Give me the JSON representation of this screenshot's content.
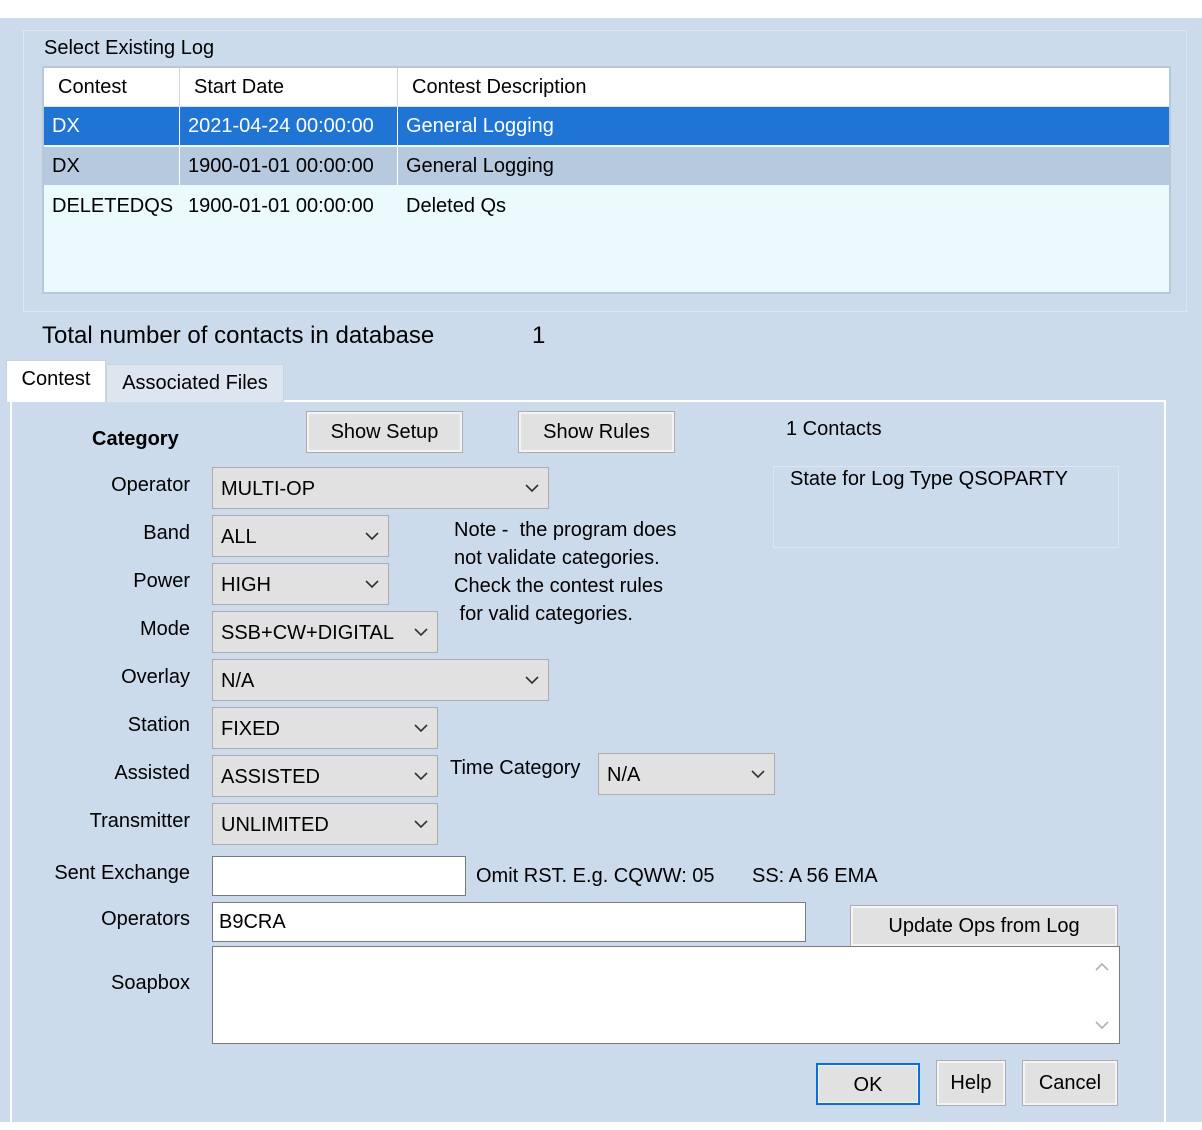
{
  "log_selector": {
    "title": "Select Existing Log",
    "columns": [
      "Contest",
      "Start Date",
      "Contest Description"
    ],
    "rows": [
      {
        "contest": "DX",
        "start_date": "2021-04-24 00:00:00",
        "description": "General Logging",
        "state": "selected"
      },
      {
        "contest": "DX",
        "start_date": "1900-01-01 00:00:00",
        "description": "General Logging",
        "state": "secondary"
      },
      {
        "contest": "DELETEDQS",
        "start_date": "1900-01-01 00:00:00",
        "description": "Deleted Qs",
        "state": "normal"
      }
    ]
  },
  "totals": {
    "label": "Total number of contacts in database",
    "value": "1"
  },
  "tabs": [
    {
      "label": "Contest",
      "active": true
    },
    {
      "label": "Associated Files",
      "active": false
    }
  ],
  "contest_tab": {
    "category_heading": "Category",
    "show_setup": "Show Setup",
    "show_rules": "Show Rules",
    "contacts": "1 Contacts",
    "state_label": "State for Log Type QSOPARTY",
    "fields": {
      "operator": {
        "label": "Operator",
        "value": "MULTI-OP"
      },
      "band": {
        "label": "Band",
        "value": "ALL"
      },
      "power": {
        "label": "Power",
        "value": "HIGH"
      },
      "mode": {
        "label": "Mode",
        "value": "SSB+CW+DIGITAL"
      },
      "overlay": {
        "label": "Overlay",
        "value": "N/A"
      },
      "station": {
        "label": "Station",
        "value": "FIXED"
      },
      "assisted": {
        "label": "Assisted",
        "value": "ASSISTED"
      },
      "transmitter": {
        "label": "Transmitter",
        "value": "UNLIMITED"
      },
      "time_category": {
        "label": "Time Category",
        "value": "N/A"
      }
    },
    "note": "Note -  the program does\nnot validate categories.\nCheck the contest rules\n for valid categories.",
    "sent_exchange": {
      "label": "Sent Exchange",
      "value": "",
      "hint1": "Omit RST. E.g. CQWW: 05",
      "hint2": "SS: A 56 EMA"
    },
    "operators": {
      "label": "Operators",
      "value": "B9CRA"
    },
    "update_ops": "Update Ops from Log",
    "soapbox": {
      "label": "Soapbox",
      "value": ""
    },
    "ok": "OK",
    "help": "Help",
    "cancel": "Cancel"
  },
  "colors": {
    "dialog_bg": "#ccdbeb",
    "selected_row": "#1f74d4",
    "secondary_row": "#b6c9df",
    "list_bg": "#eafafd"
  }
}
